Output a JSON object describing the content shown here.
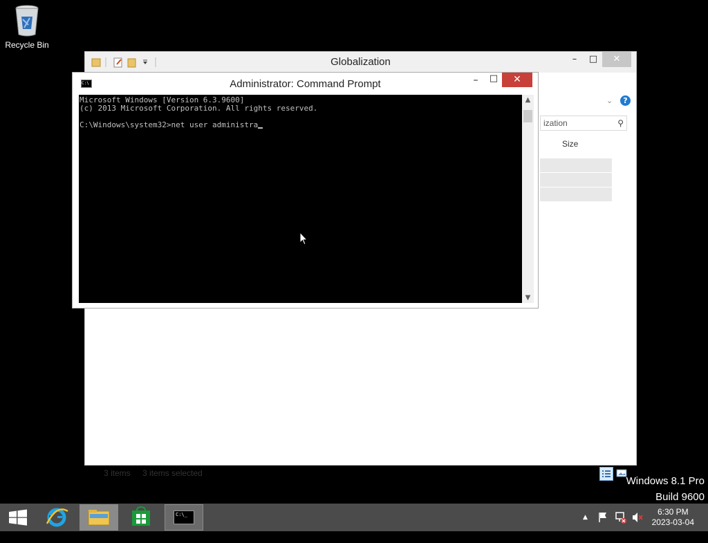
{
  "desktop": {
    "recycle_bin_label": "Recycle Bin"
  },
  "explorer": {
    "title": "Globalization",
    "minimize": "–",
    "maximize": "□",
    "close": "✕",
    "search_placeholder": "ization",
    "column_size": "Size",
    "status": {
      "items": "3 items",
      "selected": "3 items selected"
    }
  },
  "cmd": {
    "title": "Administrator: Command Prompt",
    "icon_text": "C:\\",
    "minimize": "–",
    "maximize": "□",
    "close": "✕",
    "lines": [
      "Microsoft Windows [Version 6.3.9600]",
      "(c) 2013 Microsoft Corporation. All rights reserved.",
      "",
      "C:\\Windows\\system32>net user administra"
    ]
  },
  "watermark": {
    "line1": "Windows 8.1 Pro",
    "line2": "Build 9600"
  },
  "taskbar": {
    "time": "6:30 PM",
    "date": "2023-03-04",
    "cmd_icon_text": "C:\\_"
  },
  "colors": {
    "taskbar": "#4b4b4b",
    "close_button": "#c7403a",
    "console_text": "#c0c0c0"
  }
}
